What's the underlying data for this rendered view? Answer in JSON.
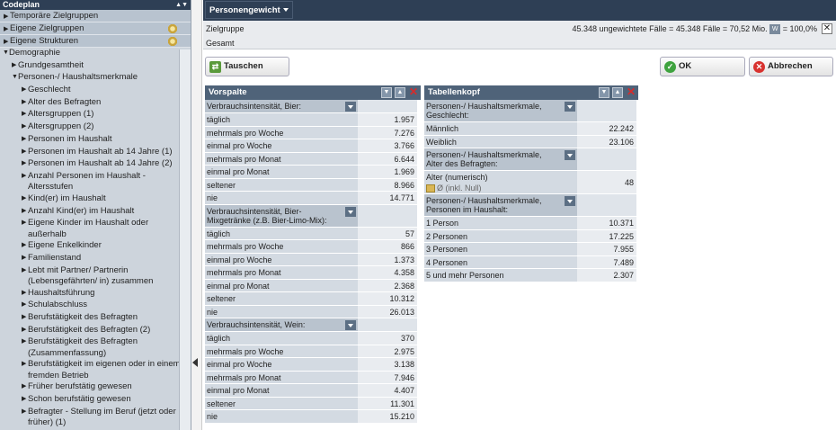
{
  "left": {
    "title": "Codeplan",
    "groups": [
      {
        "label": "Temporäre Zielgruppen",
        "gear": false
      },
      {
        "label": "Eigene Zielgruppen",
        "gear": true
      },
      {
        "label": "Eigene Strukturen",
        "gear": true
      }
    ],
    "tree": [
      {
        "label": "Demographie",
        "level": 0,
        "expanded": true
      },
      {
        "label": "Grundgesamtheit",
        "level": 1,
        "expanded": false
      },
      {
        "label": "Personen-/ Haushaltsmerkmale",
        "level": 1,
        "expanded": true
      },
      {
        "label": "Geschlecht",
        "level": 2
      },
      {
        "label": "Alter des Befragten",
        "level": 2
      },
      {
        "label": "Altersgruppen (1)",
        "level": 2
      },
      {
        "label": "Altersgruppen (2)",
        "level": 2
      },
      {
        "label": "Personen im Haushalt",
        "level": 2
      },
      {
        "label": "Personen im Haushalt ab 14 Jahre (1)",
        "level": 2
      },
      {
        "label": "Personen im Haushalt ab 14 Jahre (2)",
        "level": 2
      },
      {
        "label": "Anzahl Personen im Haushalt - Altersstufen",
        "level": 2
      },
      {
        "label": "Kind(er) im Haushalt",
        "level": 2
      },
      {
        "label": "Anzahl Kind(er) im Haushalt",
        "level": 2
      },
      {
        "label": "Eigene Kinder im Haushalt oder außerhalb",
        "level": 2
      },
      {
        "label": "Eigene Enkelkinder",
        "level": 2
      },
      {
        "label": "Familienstand",
        "level": 2
      },
      {
        "label": "Lebt mit Partner/ Partnerin (Lebensgefährten/ in) zusammen",
        "level": 2
      },
      {
        "label": "Haushaltsführung",
        "level": 2
      },
      {
        "label": "Schulabschluss",
        "level": 2
      },
      {
        "label": "Berufstätigkeit des Befragten",
        "level": 2
      },
      {
        "label": "Berufstätigkeit des Befragten (2)",
        "level": 2
      },
      {
        "label": "Berufstätigkeit des Befragten (Zusammenfassung)",
        "level": 2
      },
      {
        "label": "Berufstätigkeit im eigenen oder in einem fremden Betrieb",
        "level": 2
      },
      {
        "label": "Früher berufstätig gewesen",
        "level": 2
      },
      {
        "label": "Schon berufstätig gewesen",
        "level": 2
      },
      {
        "label": "Befragter - Stellung im Beruf (jetzt oder früher) (1)",
        "level": 2
      }
    ]
  },
  "topbar": {
    "dropdown": "Personengewicht"
  },
  "info": {
    "zielgruppe": "Zielgruppe",
    "gesamt": "Gesamt",
    "stats": "45.348 ungewichtete Fälle = 45.348 Fälle = 70,52 Mio.",
    "pct": "= 100,0%",
    "w_icon": "W"
  },
  "buttons": {
    "tauschen": "Tauschen",
    "ok": "OK",
    "abbrechen": "Abbrechen"
  },
  "vorspalte": {
    "title": "Vorspalte",
    "sections": [
      {
        "header": "Verbrauchsintensität, Bier:",
        "rows": [
          {
            "label": "täglich",
            "value": "1.957"
          },
          {
            "label": "mehrmals pro Woche",
            "value": "7.276"
          },
          {
            "label": "einmal pro Woche",
            "value": "3.766"
          },
          {
            "label": "mehrmals pro Monat",
            "value": "6.644"
          },
          {
            "label": "einmal pro Monat",
            "value": "1.969"
          },
          {
            "label": "seltener",
            "value": "8.966"
          },
          {
            "label": "nie",
            "value": "14.771"
          }
        ]
      },
      {
        "header": "Verbrauchsintensität, Bier-Mixgetränke (z.B. Bier-Limo-Mix):",
        "rows": [
          {
            "label": "täglich",
            "value": "57"
          },
          {
            "label": "mehrmals pro Woche",
            "value": "866"
          },
          {
            "label": "einmal pro Woche",
            "value": "1.373"
          },
          {
            "label": "mehrmals pro Monat",
            "value": "4.358"
          },
          {
            "label": "einmal pro Monat",
            "value": "2.368"
          },
          {
            "label": "seltener",
            "value": "10.312"
          },
          {
            "label": "nie",
            "value": "26.013"
          }
        ]
      },
      {
        "header": "Verbrauchsintensität, Wein:",
        "rows": [
          {
            "label": "täglich",
            "value": "370"
          },
          {
            "label": "mehrmals pro Woche",
            "value": "2.975"
          },
          {
            "label": "einmal pro Woche",
            "value": "3.138"
          },
          {
            "label": "mehrmals pro Monat",
            "value": "7.946"
          },
          {
            "label": "einmal pro Monat",
            "value": "4.407"
          },
          {
            "label": "seltener",
            "value": "11.301"
          },
          {
            "label": "nie",
            "value": "15.210"
          }
        ]
      }
    ]
  },
  "tabellenkopf": {
    "title": "Tabellenkopf",
    "sections": [
      {
        "header": "Personen-/ Haushaltsmerkmale, Geschlecht:",
        "rows": [
          {
            "label": "Männlich",
            "value": "22.242"
          },
          {
            "label": "Weiblich",
            "value": "23.106"
          }
        ]
      },
      {
        "header": "Personen-/ Haushaltsmerkmale, Alter des Befragten:",
        "rows": [
          {
            "label": "Alter (numerisch)",
            "sub": "Ø (inkl. Null)",
            "value": "48"
          }
        ]
      },
      {
        "header": "Personen-/ Haushaltsmerkmale, Personen im Haushalt:",
        "rows": [
          {
            "label": "1 Person",
            "value": "10.371"
          },
          {
            "label": "2 Personen",
            "value": "17.225"
          },
          {
            "label": "3 Personen",
            "value": "7.955"
          },
          {
            "label": "4 Personen",
            "value": "7.489"
          },
          {
            "label": "5 und mehr Personen",
            "value": "2.307"
          }
        ]
      }
    ]
  }
}
